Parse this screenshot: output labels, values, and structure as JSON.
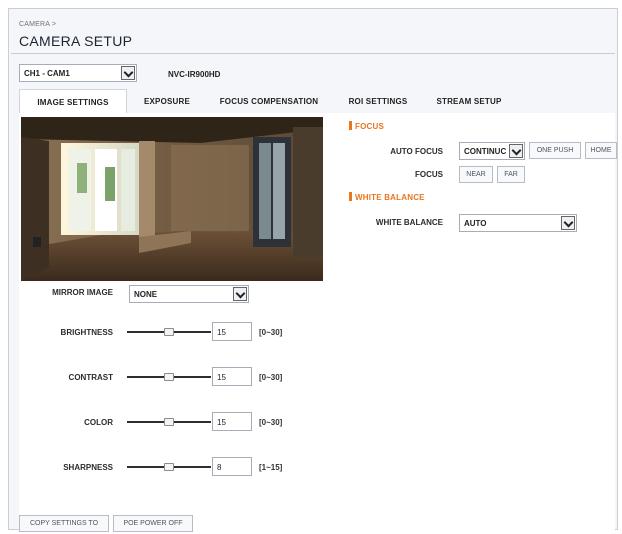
{
  "header": {
    "breadcrumb": "CAMERA >",
    "title": "CAMERA SETUP"
  },
  "camera_select": {
    "value": "CH1 - CAM1"
  },
  "model": "NVC-IR900HD",
  "tabs": [
    {
      "label": "IMAGE SETTINGS",
      "active": true
    },
    {
      "label": "EXPOSURE"
    },
    {
      "label": "FOCUS COMPENSATION"
    },
    {
      "label": "ROI SETTINGS"
    },
    {
      "label": "STREAM SETUP"
    }
  ],
  "image_settings": {
    "mirror_image": {
      "label": "MIRROR IMAGE",
      "value": "NONE"
    },
    "sliders": [
      {
        "label": "BRIGHTNESS",
        "value": "15",
        "range": "[0~30]",
        "fraction": 0.5
      },
      {
        "label": "CONTRAST",
        "value": "15",
        "range": "[0~30]",
        "fraction": 0.5
      },
      {
        "label": "COLOR",
        "value": "15",
        "range": "[0~30]",
        "fraction": 0.5
      },
      {
        "label": "SHARPNESS",
        "value": "8",
        "range": "[1~15]",
        "fraction": 0.5
      }
    ]
  },
  "focus": {
    "section_title": "FOCUS",
    "auto_focus_label": "AUTO FOCUS",
    "auto_focus_value": "CONTINUC",
    "one_push_label": "ONE PUSH",
    "home_label": "HOME",
    "focus_label": "FOCUS",
    "near_label": "NEAR",
    "far_label": "FAR"
  },
  "white_balance": {
    "section_title": "WHITE BALANCE",
    "label": "WHITE BALANCE",
    "value": "AUTO"
  },
  "footer": {
    "copy_settings_label": "COPY SETTINGS TO",
    "poe_power_off_label": "POE POWER OFF"
  },
  "colors": {
    "accent": "#e8761e",
    "panel_background": "#f4f6f9"
  },
  "icons": [
    "chevron-down-icon"
  ]
}
